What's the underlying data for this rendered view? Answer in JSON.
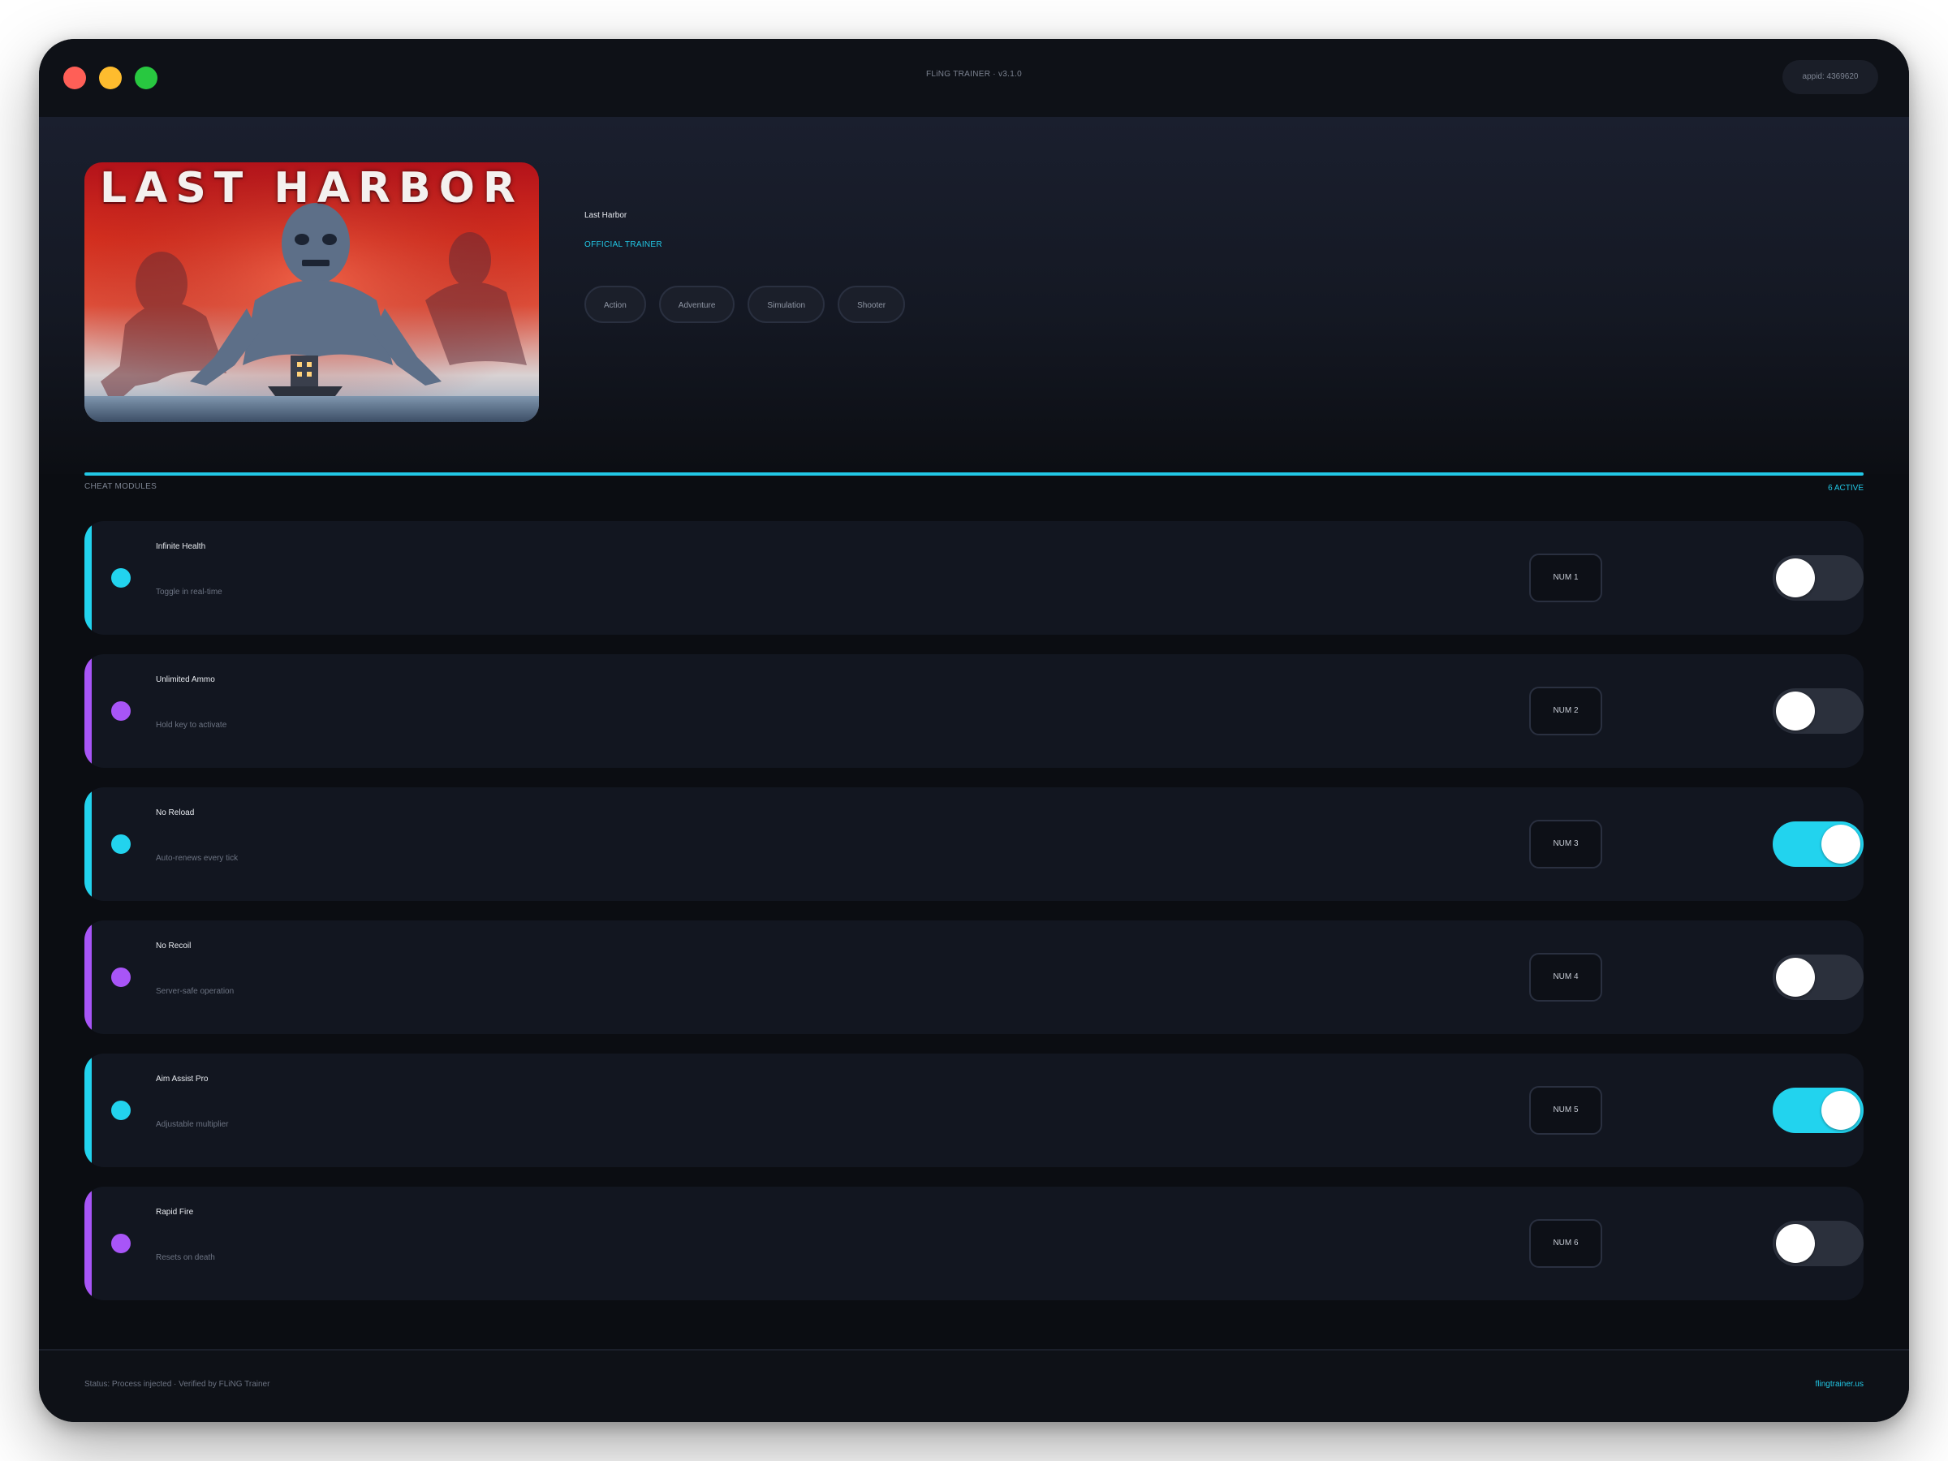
{
  "window": {
    "title": "FLiNG TRAINER · v3.1.0",
    "appid": "appid: 4369620"
  },
  "game": {
    "cover_title": "LAST HARBOR",
    "name": "Last Harbor",
    "badge": "OFFICIAL TRAINER",
    "tags": [
      "Action",
      "Adventure",
      "Simulation",
      "Shooter"
    ]
  },
  "section": {
    "label": "CHEAT MODULES",
    "count": "6 ACTIVE"
  },
  "colors": {
    "accent_cyan": "#22d3ee",
    "accent_purple": "#a855f7"
  },
  "modules": [
    {
      "name": "Infinite Health",
      "desc": "Toggle in real-time",
      "key": "NUM 1",
      "enabled": false,
      "accent": "cyan"
    },
    {
      "name": "Unlimited Ammo",
      "desc": "Hold key to activate",
      "key": "NUM 2",
      "enabled": false,
      "accent": "purple"
    },
    {
      "name": "No Reload",
      "desc": "Auto-renews every tick",
      "key": "NUM 3",
      "enabled": true,
      "accent": "cyan"
    },
    {
      "name": "No Recoil",
      "desc": "Server-safe operation",
      "key": "NUM 4",
      "enabled": false,
      "accent": "purple"
    },
    {
      "name": "Aim Assist Pro",
      "desc": "Adjustable multiplier",
      "key": "NUM 5",
      "enabled": true,
      "accent": "cyan"
    },
    {
      "name": "Rapid Fire",
      "desc": "Resets on death",
      "key": "NUM 6",
      "enabled": false,
      "accent": "purple"
    }
  ],
  "footer": {
    "status": "Status: Process injected · Verified by FLiNG Trainer",
    "link": "flingtrainer.us"
  }
}
